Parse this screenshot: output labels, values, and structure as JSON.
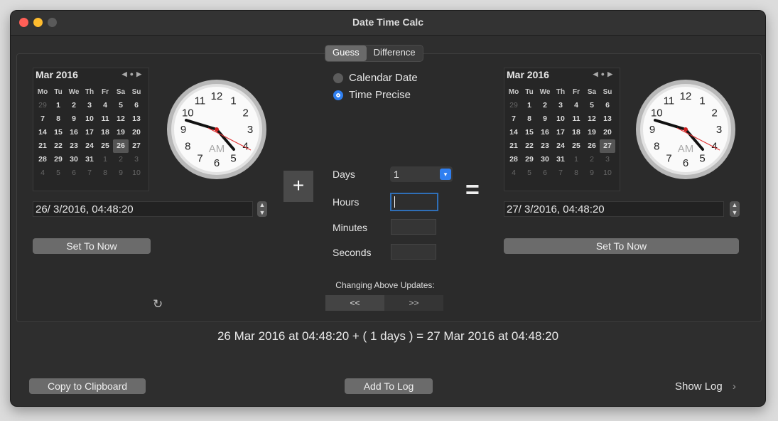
{
  "window": {
    "title": "Date Time Calc"
  },
  "tabs": {
    "guess": "Guess",
    "difference": "Difference"
  },
  "left": {
    "month": "Mar 2016",
    "date_field": "26/  3/2016, 04:48:20",
    "set_now": "Set To Now",
    "clock_ampm": "AM"
  },
  "right": {
    "month": "Mar 2016",
    "date_field": "27/  3/2016, 04:48:20",
    "set_now": "Set To Now",
    "clock_ampm": "AM"
  },
  "calendar": {
    "dow": [
      "Mo",
      "Tu",
      "We",
      "Th",
      "Fr",
      "Sa",
      "Su"
    ],
    "weeks": [
      [
        "29",
        "1",
        "2",
        "3",
        "4",
        "5",
        "6"
      ],
      [
        "7",
        "8",
        "9",
        "10",
        "11",
        "12",
        "13"
      ],
      [
        "14",
        "15",
        "16",
        "17",
        "18",
        "19",
        "20"
      ],
      [
        "21",
        "22",
        "23",
        "24",
        "25",
        "26",
        "27"
      ],
      [
        "28",
        "29",
        "30",
        "31",
        "1",
        "2",
        "3"
      ],
      [
        "4",
        "5",
        "6",
        "7",
        "8",
        "9",
        "10"
      ]
    ]
  },
  "mode": {
    "calendar_date": "Calendar Date",
    "time_precise": "Time Precise",
    "selected": "Time Precise"
  },
  "operator": {
    "plus": "+",
    "equals": "="
  },
  "inputs": {
    "days_label": "Days",
    "days_value": "1",
    "hours_label": "Hours",
    "hours_value": "",
    "minutes_label": "Minutes",
    "minutes_value": "",
    "seconds_label": "Seconds",
    "seconds_value": ""
  },
  "updates": {
    "label": "Changing Above Updates:",
    "left": "<<",
    "right": ">>"
  },
  "result": "26 Mar 2016 at 04:48:20 + ( 1 days ) = 27 Mar 2016 at 04:48:20",
  "footer": {
    "copy": "Copy to Clipboard",
    "add_log": "Add To Log",
    "show_log": "Show Log"
  },
  "colors": {
    "accent": "#2f7ff0",
    "close": "#ff5f57",
    "minimize": "#febc2e",
    "zoom": "#5a5a5a",
    "second_hand": "#e03030"
  }
}
